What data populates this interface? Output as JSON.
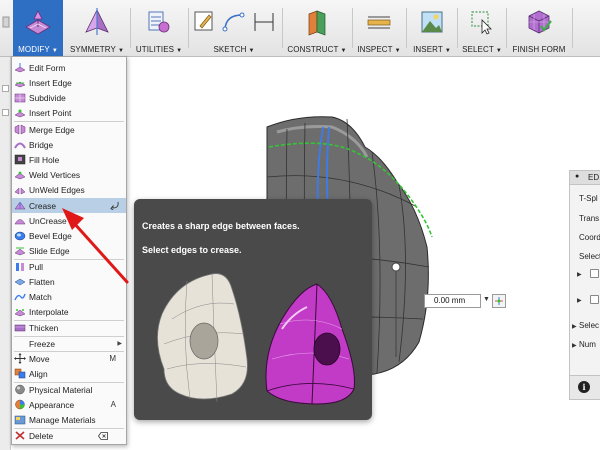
{
  "toolbar": {
    "modify": "MODIFY",
    "symmetry": "SYMMETRY",
    "utilities": "UTILITIES",
    "sketch": "SKETCH",
    "construct": "CONSTRUCT",
    "inspect": "INSPECT",
    "insert": "INSERT",
    "select": "SELECT",
    "finish_form": "FINISH FORM",
    "caret": "▼"
  },
  "menu": {
    "items": [
      {
        "label": "Edit Form"
      },
      {
        "label": "Insert Edge"
      },
      {
        "label": "Subdivide"
      },
      {
        "label": "Insert Point"
      },
      {
        "label": "Merge Edge"
      },
      {
        "label": "Bridge"
      },
      {
        "label": "Fill Hole"
      },
      {
        "label": "Weld Vertices"
      },
      {
        "label": "UnWeld Edges"
      },
      {
        "label": "Crease"
      },
      {
        "label": "UnCrease"
      },
      {
        "label": "Bevel Edge"
      },
      {
        "label": "Slide Edge"
      },
      {
        "label": "Pull"
      },
      {
        "label": "Flatten"
      },
      {
        "label": "Match"
      },
      {
        "label": "Interpolate"
      },
      {
        "label": "Thicken"
      },
      {
        "label": "Freeze"
      },
      {
        "label": "Move",
        "shortcut": "M"
      },
      {
        "label": "Align"
      },
      {
        "label": "Physical Material"
      },
      {
        "label": "Appearance",
        "shortcut": "A"
      },
      {
        "label": "Manage Materials"
      },
      {
        "label": "Delete"
      }
    ],
    "submenu_arrow": "▶",
    "highlight_color": "#b8cfe6"
  },
  "tooltip": {
    "line1": "Creates a sharp edge between faces.",
    "line2": "Select edges to crease."
  },
  "value_field": {
    "value": "0.00 mm",
    "dropdown": "▼"
  },
  "right_panel": {
    "header": "ED",
    "rows": [
      "T-Spl",
      "Trans",
      "Coord",
      "Select"
    ],
    "row_sel": "Selec",
    "row_num": "Num",
    "info": "i"
  },
  "colors": {
    "accent": "#2e6fc4",
    "arrow": "#e01818",
    "crease_magenta": "#c23bc6",
    "tooltip_bg": "#4a4a4a"
  }
}
